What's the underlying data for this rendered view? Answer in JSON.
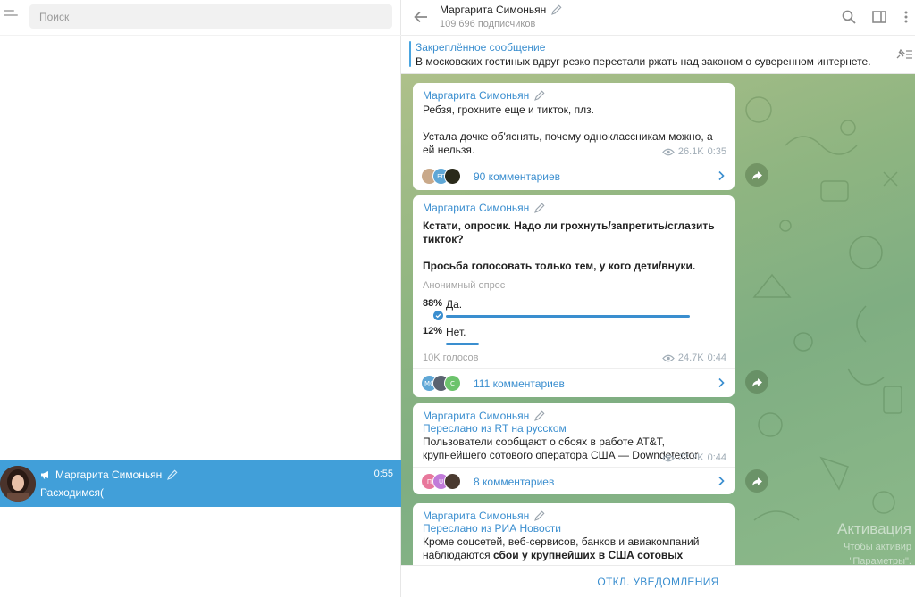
{
  "sidebar": {
    "search_placeholder": "Поиск",
    "active_chat": {
      "name": "Маргарита Симоньян",
      "time": "0:55",
      "preview": "Расходимся("
    }
  },
  "header": {
    "title": "Маргарита Симоньян",
    "subtitle": "109 696 подписчиков"
  },
  "pinned": {
    "title": "Закреплённое сообщение",
    "text": "В московских гостиных вдруг резко перестали ржать над законом о суверенном интернете."
  },
  "messages": [
    {
      "author": "Маргарита Симоньян",
      "text1": "Ребзя, грохните еще и тикток, плз.",
      "text2": "Устала дочке об'яснять, почему одноклассникам можно, а ей нельзя.",
      "views": "26.1K",
      "time": "0:35",
      "comments": "90 комментариев",
      "avatars": [
        "",
        "ЕГ",
        ""
      ]
    },
    {
      "author": "Маргарита Симоньян",
      "question1": "Кстати, опросик. Надо ли грохнуть/запретить/сглазить тикток?",
      "question2": "Просьба голосовать только тем, у  кого дети/внуки.",
      "poll_label": "Анонимный опрос",
      "options": [
        {
          "pct": "88%",
          "label": "Да.",
          "value": 0.88
        },
        {
          "pct": "12%",
          "label": "Нет.",
          "value": 0.12
        }
      ],
      "votes": "10K голосов",
      "views": "24.7K",
      "time": "0:44",
      "comments": "111 комментариев",
      "avatars": [
        "МС",
        "",
        "С"
      ]
    },
    {
      "author": "Маргарита Симоньян",
      "forwarded": "Переслано из RT на русском",
      "text": "Пользователи сообщают о сбоях в работе AT&T, крупнейшего сотового оператора США — Downdetector",
      "views": "22.2K",
      "time": "0:44",
      "comments": "8 комментариев",
      "avatars": [
        "П",
        "U",
        ""
      ]
    },
    {
      "author": "Маргарита Симоньян",
      "forwarded": "Переслано из РИА Новости",
      "text_plain": "Кроме соцсетей, веб-сервисов, банков и авиакомпаний наблюдаются ",
      "text_bold": "сбои у крупнейших в США сотовых операторов"
    }
  ],
  "watermark": {
    "title": "Активация",
    "line1": "Чтобы активир",
    "line2": "\"Параметры\"."
  },
  "footer": {
    "mute_label": "ОТКЛ. УВЕДОМЛЕНИЯ"
  },
  "colors": {
    "accent": "#3a8ecf",
    "active_chat_bg": "#419fd9"
  }
}
